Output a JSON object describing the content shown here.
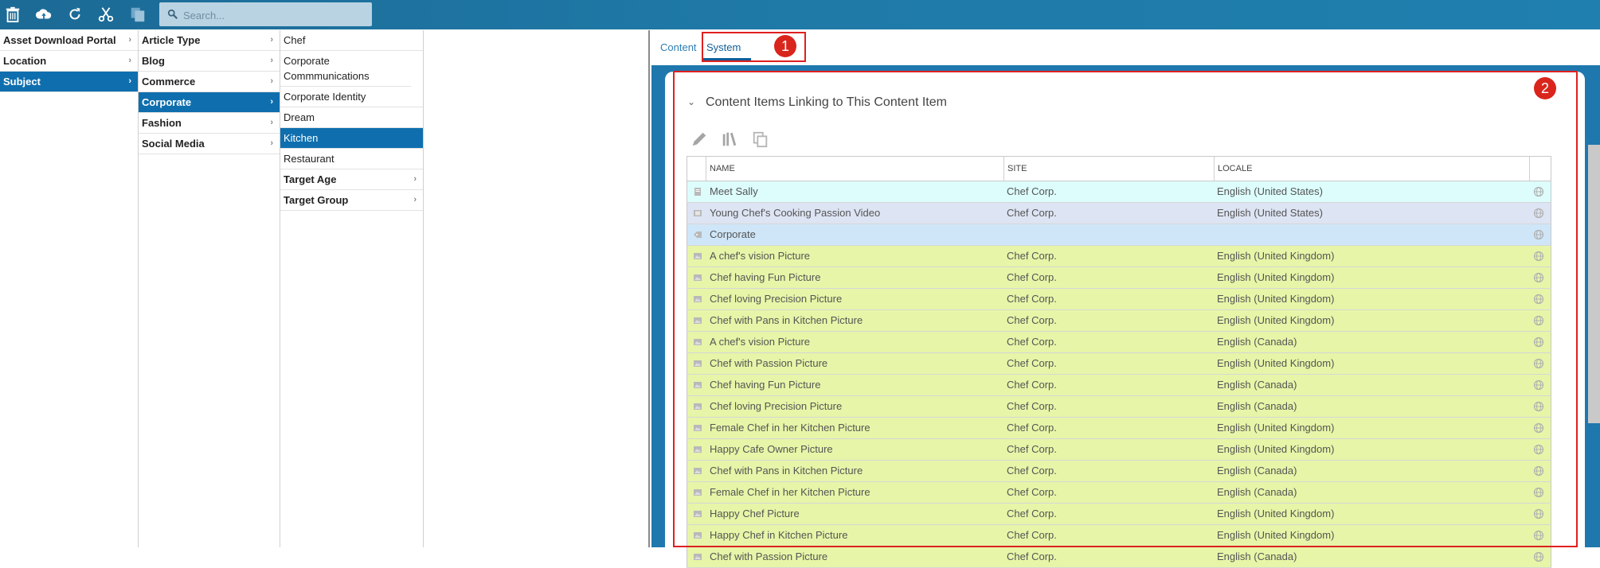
{
  "toolbar": {
    "icons": [
      "trash-icon",
      "cloud-upload-icon",
      "refresh-icon",
      "cut-icon",
      "copy-icon"
    ],
    "search_placeholder": "Search..."
  },
  "columns": {
    "col1": [
      {
        "label": "Asset Download Portal",
        "chevron": true,
        "selected": false
      },
      {
        "label": "Location",
        "chevron": true,
        "selected": false
      },
      {
        "label": "Subject",
        "chevron": true,
        "selected": true
      }
    ],
    "col2": [
      {
        "label": "Article Type",
        "chevron": true,
        "selected": false
      },
      {
        "label": "Blog",
        "chevron": true,
        "selected": false
      },
      {
        "label": "Commerce",
        "chevron": true,
        "selected": false
      },
      {
        "label": "Corporate",
        "chevron": true,
        "selected": true
      },
      {
        "label": "Fashion",
        "chevron": true,
        "selected": false
      },
      {
        "label": "Social Media",
        "chevron": true,
        "selected": false
      }
    ],
    "col3": [
      {
        "label": "Chef",
        "bold": false,
        "selected": false
      },
      {
        "label": "Corporate Commmunications",
        "bold": false,
        "selected": false
      },
      {
        "label": "Corporate Identity",
        "bold": false,
        "selected": false
      },
      {
        "label": "Dream",
        "bold": false,
        "selected": false
      },
      {
        "label": "Kitchen",
        "bold": false,
        "selected": true
      },
      {
        "label": "Restaurant",
        "bold": false,
        "selected": false
      },
      {
        "label": "Target Age",
        "bold": true,
        "selected": false,
        "chevron": true
      },
      {
        "label": "Target Group",
        "bold": true,
        "selected": false,
        "chevron": true
      }
    ]
  },
  "panel": {
    "tabs": [
      {
        "label": "Content",
        "active": false
      },
      {
        "label": "System",
        "active": true
      }
    ],
    "badge1": "1",
    "badge2": "2",
    "section_title": "Content Items Linking to This Content Item",
    "action_icons": [
      "pencil-icon",
      "library-icon",
      "duplicate-icon"
    ],
    "grid": {
      "headers": [
        "NAME",
        "SITE",
        "LOCALE"
      ],
      "rows": [
        {
          "type": "article",
          "name": "Meet Sally",
          "site": "Chef Corp.",
          "locale": "English (United States)",
          "color": "cyan"
        },
        {
          "type": "video",
          "name": "Young Chef's Cooking Passion Video",
          "site": "Chef Corp.",
          "locale": "English (United States)",
          "color": "lav"
        },
        {
          "type": "tag",
          "name": "Corporate",
          "site": "",
          "locale": "",
          "color": "blue"
        },
        {
          "type": "picture",
          "name": "A chef's vision Picture",
          "site": "Chef Corp.",
          "locale": "English (United Kingdom)",
          "color": "green"
        },
        {
          "type": "picture",
          "name": "Chef having Fun Picture",
          "site": "Chef Corp.",
          "locale": "English (United Kingdom)",
          "color": "green"
        },
        {
          "type": "picture",
          "name": "Chef loving Precision Picture",
          "site": "Chef Corp.",
          "locale": "English (United Kingdom)",
          "color": "green"
        },
        {
          "type": "picture",
          "name": "Chef with Pans in Kitchen Picture",
          "site": "Chef Corp.",
          "locale": "English (United Kingdom)",
          "color": "green"
        },
        {
          "type": "picture",
          "name": "A chef's vision Picture",
          "site": "Chef Corp.",
          "locale": "English (Canada)",
          "color": "green"
        },
        {
          "type": "picture",
          "name": "Chef with Passion Picture",
          "site": "Chef Corp.",
          "locale": "English (United Kingdom)",
          "color": "green"
        },
        {
          "type": "picture",
          "name": "Chef having Fun Picture",
          "site": "Chef Corp.",
          "locale": "English (Canada)",
          "color": "green"
        },
        {
          "type": "picture",
          "name": "Chef loving Precision Picture",
          "site": "Chef Corp.",
          "locale": "English (Canada)",
          "color": "green"
        },
        {
          "type": "picture",
          "name": "Female Chef in her Kitchen Picture",
          "site": "Chef Corp.",
          "locale": "English (United Kingdom)",
          "color": "green"
        },
        {
          "type": "picture",
          "name": "Happy Cafe Owner Picture",
          "site": "Chef Corp.",
          "locale": "English (United Kingdom)",
          "color": "green"
        },
        {
          "type": "picture",
          "name": "Chef with Pans in Kitchen Picture",
          "site": "Chef Corp.",
          "locale": "English (Canada)",
          "color": "green"
        },
        {
          "type": "picture",
          "name": "Female Chef in her Kitchen Picture",
          "site": "Chef Corp.",
          "locale": "English (Canada)",
          "color": "green"
        },
        {
          "type": "picture",
          "name": "Happy Chef Picture",
          "site": "Chef Corp.",
          "locale": "English (United Kingdom)",
          "color": "green"
        },
        {
          "type": "picture",
          "name": "Happy Chef in Kitchen Picture",
          "site": "Chef Corp.",
          "locale": "English (United Kingdom)",
          "color": "green"
        },
        {
          "type": "picture",
          "name": "Chef with Passion Picture",
          "site": "Chef Corp.",
          "locale": "English (Canada)",
          "color": "green"
        }
      ]
    }
  }
}
